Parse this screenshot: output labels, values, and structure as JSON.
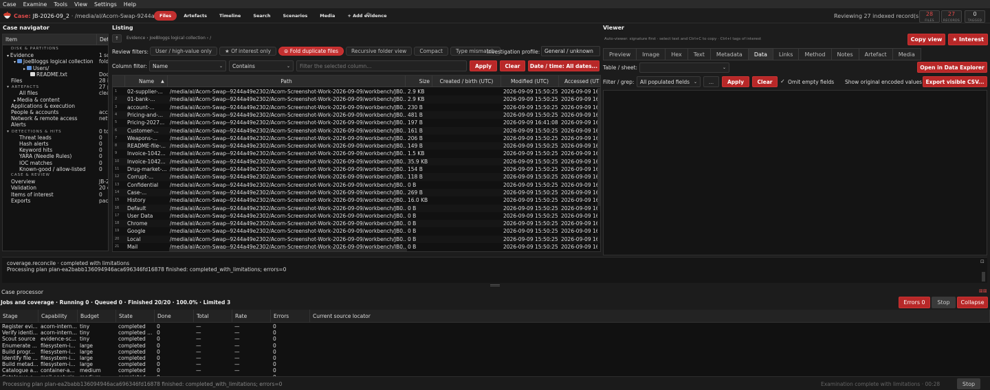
{
  "menu": [
    "Case",
    "Examine",
    "Tools",
    "View",
    "Settings",
    "Help"
  ],
  "header": {
    "case_label": "Case:",
    "case_id": "JB-2026-09_2",
    "case_path": "· /media/al/Acorn-Swap-9244a49",
    "tabs": [
      "Files",
      "Artefacts",
      "Timeline",
      "Search",
      "Scenarios",
      "Media",
      "+ Add evidence"
    ],
    "active_tab": "Files",
    "reviewing": "Reviewing 27 indexed record(s)",
    "counters": [
      {
        "value": "28",
        "label": "FILES"
      },
      {
        "value": "27",
        "label": "RECORDS"
      },
      {
        "value": "0",
        "label": "TAGGED"
      }
    ]
  },
  "navigator": {
    "title": "Case navigator",
    "columns": [
      "Item",
      "Det"
    ],
    "rows": [
      {
        "text": "DISK & PARTITIONS",
        "detail": "",
        "indent": 12,
        "section": true
      },
      {
        "text": "Evidence",
        "detail": "1 so",
        "indent": 6,
        "arrow": "▾"
      },
      {
        "text": "JoeBloggs logical collection",
        "detail": "folde",
        "indent": 16,
        "arrow": "▾",
        "icon": "db"
      },
      {
        "text": "Users/",
        "detail": "",
        "indent": 30,
        "arrow": "▸",
        "icon": "folder"
      },
      {
        "text": "README.txt",
        "detail": "Docu",
        "indent": 40,
        "icon": "file"
      },
      {
        "text": "Files",
        "detail": "28 in",
        "indent": 12
      },
      {
        "text": "ARTEFACTS",
        "detail": "27 p",
        "indent": 6,
        "arrow": "▾",
        "section": true
      },
      {
        "text": "All files",
        "detail": "clear",
        "indent": 24
      },
      {
        "text": "Media & content",
        "detail": "",
        "indent": 16,
        "arrow": "▸"
      },
      {
        "text": "Applications & execution",
        "detail": "",
        "indent": 12
      },
      {
        "text": "People & accounts",
        "detail": "acco",
        "indent": 12
      },
      {
        "text": "Network & remote access",
        "detail": "netw",
        "indent": 12
      },
      {
        "text": "Alerts",
        "detail": "",
        "indent": 12
      },
      {
        "text": "DETECTIONS & HITS",
        "detail": "0 to",
        "indent": 6,
        "arrow": "▾",
        "section": true
      },
      {
        "text": "Threat leads",
        "detail": "0",
        "indent": 24
      },
      {
        "text": "Hash alerts",
        "detail": "0",
        "indent": 24
      },
      {
        "text": "Keyword hits",
        "detail": "0",
        "indent": 24
      },
      {
        "text": "YARA (Needle Rules)",
        "detail": "0",
        "indent": 24
      },
      {
        "text": "IOC matches",
        "detail": "0",
        "indent": 24
      },
      {
        "text": "Known-good / allow-listed",
        "detail": "0",
        "indent": 24
      },
      {
        "text": "CASE & REVIEW",
        "detail": "",
        "indent": 12,
        "section": true
      },
      {
        "text": "Overview",
        "detail": "JB-2",
        "indent": 12
      },
      {
        "text": "Validation",
        "detail": "20 cl",
        "indent": 12
      },
      {
        "text": "Items of interest",
        "detail": "0",
        "indent": 12
      },
      {
        "text": "Exports",
        "detail": "pack",
        "indent": 12
      }
    ]
  },
  "listing": {
    "title": "Listing",
    "breadcrumb": "Evidence › JoeBloggs logical collection › /",
    "up_label": "↑",
    "review_filters_label": "Review filters:",
    "filters": [
      "User / high-value only",
      "★ Of interest only",
      "⊜ Fold duplicate files",
      "Recursive folder view",
      "Compact",
      "Type mismatch"
    ],
    "active_filter": "⊜ Fold duplicate files",
    "profile_label": "Investigation profile:",
    "profile_value": "General / unknown",
    "column_filter_label": "Column filter:",
    "column_select": "Name",
    "operator_select": "Contains",
    "filter_placeholder": "Filter the selected column...",
    "apply": "Apply",
    "clear": "Clear",
    "date_button": "Date / time: All dates...",
    "columns": [
      "",
      "Name",
      "Path",
      "Size",
      "Created / birth (UTC)",
      "Modified (UTC)",
      "Accessed (UT"
    ],
    "rows": [
      {
        "n": "1",
        "name": "02-supplier-...",
        "path": "/media/al/Acorn-Swap--9244a49e2302/Acorn-Screenshot-Work-2026-09-09/workbench/JB0...",
        "size": "2.9 KB",
        "created": "",
        "modified": "2026-09-09 15:50:25",
        "accessed": "2026-09-09 16:"
      },
      {
        "n": "2",
        "name": "01-bank-...",
        "path": "/media/al/Acorn-Swap--9244a49e2302/Acorn-Screenshot-Work-2026-09-09/workbench/JB0...",
        "size": "2.9 KB",
        "created": "",
        "modified": "2026-09-09 15:50:25",
        "accessed": "2026-09-09 16:"
      },
      {
        "n": "3",
        "name": "account-...",
        "path": "/media/al/Acorn-Swap--9244a49e2302/Acorn-Screenshot-Work-2026-09-09/workbench/JB0...",
        "size": "230 B",
        "created": "",
        "modified": "2026-09-09 15:50:25",
        "accessed": "2026-09-09 16:"
      },
      {
        "n": "4",
        "name": "Pricing-and-...",
        "path": "/media/al/Acorn-Swap--9244a49e2302/Acorn-Screenshot-Work-2026-09-09/workbench/JB0...",
        "size": "481 B",
        "created": "",
        "modified": "2026-09-09 15:50:25",
        "accessed": "2026-09-09 16:"
      },
      {
        "n": "5",
        "name": "Pricing-2027...",
        "path": "/media/al/Acorn-Swap--9244a49e2302/Acorn-Screenshot-Work-2026-09-09/workbench/JB0...",
        "size": "197 B",
        "created": "",
        "modified": "2026-09-09 16:41:08",
        "accessed": "2026-09-09 16:"
      },
      {
        "n": "6",
        "name": "Customer-...",
        "path": "/media/al/Acorn-Swap--9244a49e2302/Acorn-Screenshot-Work-2026-09-09/workbench/JB0...",
        "size": "161 B",
        "created": "",
        "modified": "2026-09-09 15:50:25",
        "accessed": "2026-09-09 16:"
      },
      {
        "n": "7",
        "name": "Weapons-...",
        "path": "/media/al/Acorn-Swap--9244a49e2302/Acorn-Screenshot-Work-2026-09-09/workbench/JB0...",
        "size": "206 B",
        "created": "",
        "modified": "2026-09-09 15:50:25",
        "accessed": "2026-09-09 16:"
      },
      {
        "n": "8",
        "name": "README-file-...",
        "path": "/media/al/Acorn-Swap--9244a49e2302/Acorn-Screenshot-Work-2026-09-09/workbench/JB0...",
        "size": "149 B",
        "created": "",
        "modified": "2026-09-09 15:50:25",
        "accessed": "2026-09-09 16:"
      },
      {
        "n": "9",
        "name": "Invoice-1042...",
        "path": "/media/al/Acorn-Swap--9244a49e2302/Acorn-Screenshot-Work-2026-09-09/workbench/JB0...",
        "size": "1.5 KB",
        "created": "",
        "modified": "2026-09-09 15:50:25",
        "accessed": "2026-09-09 16:"
      },
      {
        "n": "10",
        "name": "Invoice-1042...",
        "path": "/media/al/Acorn-Swap--9244a49e2302/Acorn-Screenshot-Work-2026-09-09/workbench/JB0...",
        "size": "35.9 KB",
        "created": "",
        "modified": "2026-09-09 15:50:25",
        "accessed": "2026-09-09 16:"
      },
      {
        "n": "11",
        "name": "Drug-market-...",
        "path": "/media/al/Acorn-Swap--9244a49e2302/Acorn-Screenshot-Work-2026-09-09/workbench/JB0...",
        "size": "154 B",
        "created": "",
        "modified": "2026-09-09 15:50:25",
        "accessed": "2026-09-09 16:"
      },
      {
        "n": "12",
        "name": "Corrupt-...",
        "path": "/media/al/Acorn-Swap--9244a49e2302/Acorn-Screenshot-Work-2026-09-09/workbench/JB0...",
        "size": "118 B",
        "created": "",
        "modified": "2026-09-09 15:50:25",
        "accessed": "2026-09-09 16:"
      },
      {
        "n": "13",
        "name": "Confidential",
        "path": "/media/al/Acorn-Swap--9244a49e2302/Acorn-Screenshot-Work-2026-09-09/workbench/JB0...",
        "size": "0 B",
        "created": "",
        "modified": "2026-09-09 15:50:25",
        "accessed": "2026-09-09 16:"
      },
      {
        "n": "14",
        "name": "Case-...",
        "path": "/media/al/Acorn-Swap--9244a49e2302/Acorn-Screenshot-Work-2026-09-09/workbench/JB0...",
        "size": "269 B",
        "created": "",
        "modified": "2026-09-09 15:50:25",
        "accessed": "2026-09-09 16:"
      },
      {
        "n": "15",
        "name": "History",
        "path": "/media/al/Acorn-Swap--9244a49e2302/Acorn-Screenshot-Work-2026-09-09/workbench/JB0...",
        "size": "16.0 KB",
        "created": "",
        "modified": "2026-09-09 15:50:25",
        "accessed": "2026-09-09 16:"
      },
      {
        "n": "16",
        "name": "Default",
        "path": "/media/al/Acorn-Swap--9244a49e2302/Acorn-Screenshot-Work-2026-09-09/workbench/JB0...",
        "size": "0 B",
        "created": "",
        "modified": "2026-09-09 15:50:25",
        "accessed": "2026-09-09 16:"
      },
      {
        "n": "17",
        "name": "User Data",
        "path": "/media/al/Acorn-Swap--9244a49e2302/Acorn-Screenshot-Work-2026-09-09/workbench/JB0...",
        "size": "0 B",
        "created": "",
        "modified": "2026-09-09 15:50:25",
        "accessed": "2026-09-09 16:"
      },
      {
        "n": "18",
        "name": "Chrome",
        "path": "/media/al/Acorn-Swap--9244a49e2302/Acorn-Screenshot-Work-2026-09-09/workbench/JB0...",
        "size": "0 B",
        "created": "",
        "modified": "2026-09-09 15:50:25",
        "accessed": "2026-09-09 16:"
      },
      {
        "n": "19",
        "name": "Google",
        "path": "/media/al/Acorn-Swap--9244a49e2302/Acorn-Screenshot-Work-2026-09-09/workbench/JB0...",
        "size": "0 B",
        "created": "",
        "modified": "2026-09-09 15:50:25",
        "accessed": "2026-09-09 16:"
      },
      {
        "n": "20",
        "name": "Local",
        "path": "/media/al/Acorn-Swap--9244a49e2302/Acorn-Screenshot-Work-2026-09-09/workbench/JB0...",
        "size": "0 B",
        "created": "",
        "modified": "2026-09-09 15:50:25",
        "accessed": "2026-09-09 16:"
      },
      {
        "n": "21",
        "name": "Mail",
        "path": "/media/al/Acorn-Swap--9244a49e2302/Acorn-Screenshot-Work-2026-09-09/workbench/JB0...",
        "size": "0 B",
        "created": "",
        "modified": "2026-09-09 15:50:25",
        "accessed": "2026-09-09 16:"
      }
    ]
  },
  "viewer": {
    "title": "Viewer",
    "hint": "Auto-viewer: signature first · select text and Ctrl+C to copy · Ctrl+I tags of interest",
    "copy_view": "Copy view",
    "interest": "★ Interest",
    "tabs": [
      "Preview",
      "Image",
      "Hex",
      "Text",
      "Metadata",
      "Data",
      "Links",
      "Method",
      "Notes",
      "Artefact",
      "Media"
    ],
    "active_tab": "Data",
    "table_sheet_label": "Table / sheet:",
    "table_sheet_value": "",
    "open_data_explorer": "Open in Data Explorer",
    "filter_grep_label": "Filter / grep:",
    "filter_grep_value": "All populated fields",
    "ellipsis": "...",
    "apply": "Apply",
    "clear": "Clear",
    "omit_empty": "Omit empty fields",
    "omit_checked": true,
    "show_original": "Show original encoded values",
    "export_csv": "Export visible CSV..."
  },
  "log": {
    "line1": "coverage.reconcile · completed with limitations",
    "line2": "Processing plan plan-ea2babb136094946aca696346fd16878 finished: completed_with_limitations; errors=0"
  },
  "processor": {
    "title": "Case processor",
    "summary": "Jobs and coverage · Running 0 · Queued 0 · Finished 20/20 · 100.0% · Limited 3",
    "errors_btn": "Errors 0",
    "stop_btn": "Stop",
    "collapse_btn": "Collapse",
    "columns": [
      "Stage",
      "Capability",
      "Budget",
      "State",
      "Done",
      "Total",
      "Rate",
      "Errors",
      "Current source locator"
    ],
    "rows": [
      {
        "stage": "Register evi...",
        "cap": "acorn-intern...",
        "budget": "tiny",
        "state": "completed",
        "done": "0",
        "total": "—",
        "rate": "—",
        "errors": "0"
      },
      {
        "stage": "Verify identi...",
        "cap": "acorn-intern...",
        "budget": "tiny",
        "state": "completed ...",
        "done": "0",
        "total": "—",
        "rate": "—",
        "errors": "0"
      },
      {
        "stage": "Scout source",
        "cap": "evidence-sc...",
        "budget": "tiny",
        "state": "completed",
        "done": "0",
        "total": "—",
        "rate": "—",
        "errors": "0"
      },
      {
        "stage": "Enumerate ...",
        "cap": "filesystem-i...",
        "budget": "large",
        "state": "completed",
        "done": "0",
        "total": "—",
        "rate": "—",
        "errors": "0"
      },
      {
        "stage": "Build progr...",
        "cap": "filesystem-i...",
        "budget": "large",
        "state": "completed",
        "done": "0",
        "total": "—",
        "rate": "—",
        "errors": "0"
      },
      {
        "stage": "Identify file ...",
        "cap": "filesystem-i...",
        "budget": "large",
        "state": "completed",
        "done": "0",
        "total": "—",
        "rate": "—",
        "errors": "0"
      },
      {
        "stage": "Build metad...",
        "cap": "filesystem-i...",
        "budget": "large",
        "state": "completed",
        "done": "0",
        "total": "—",
        "rate": "—",
        "errors": "0"
      },
      {
        "stage": "Catalogue a...",
        "cap": "container-a...",
        "budget": "medium",
        "state": "completed",
        "done": "0",
        "total": "—",
        "rate": "—",
        "errors": "0"
      },
      {
        "stage": "Catalogue e...",
        "cap": "mail-analysis",
        "budget": "medium",
        "state": "completed",
        "done": "0",
        "total": "—",
        "rate": "—",
        "errors": "0"
      }
    ]
  },
  "status": {
    "text": "Processing plan plan-ea2babb136094946aca696346fd16878 finished: completed_with_limitations; errors=0",
    "right": "Examination complete with limitations · 00:28",
    "stop": "Stop"
  },
  "colors": {
    "accent": "#c23030",
    "bg": "#1c1c1c"
  }
}
